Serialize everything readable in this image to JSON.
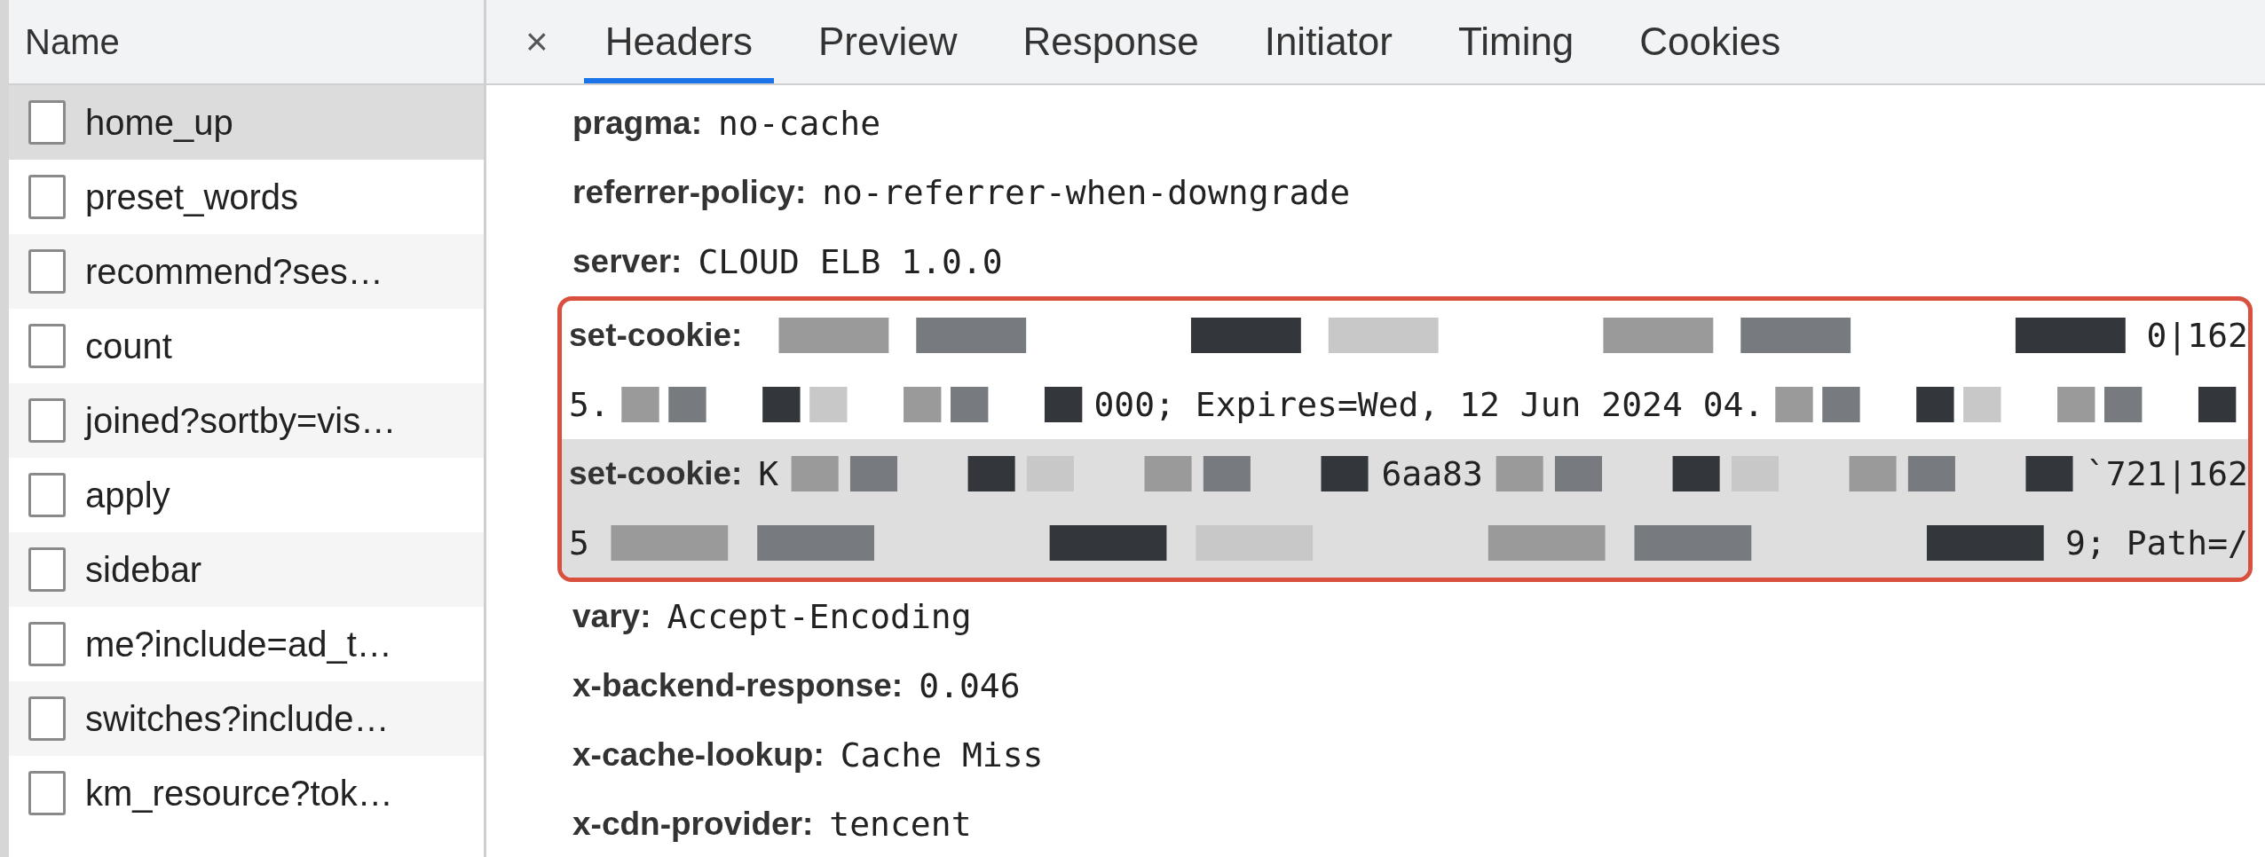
{
  "requests": {
    "column": "Name",
    "rows": [
      {
        "name": "home_up",
        "selected": true
      },
      {
        "name": "preset_words",
        "selected": false
      },
      {
        "name": "recommend?ses…",
        "selected": false
      },
      {
        "name": "count",
        "selected": false
      },
      {
        "name": "joined?sortby=vis…",
        "selected": false
      },
      {
        "name": "apply",
        "selected": false
      },
      {
        "name": "sidebar",
        "selected": false
      },
      {
        "name": "me?include=ad_t…",
        "selected": false
      },
      {
        "name": "switches?include…",
        "selected": false
      },
      {
        "name": "km_resource?tok…",
        "selected": false
      }
    ]
  },
  "details": {
    "close": "×",
    "tabs": [
      {
        "label": "Headers",
        "selected": true
      },
      {
        "label": "Preview",
        "selected": false
      },
      {
        "label": "Response",
        "selected": false
      },
      {
        "label": "Initiator",
        "selected": false
      },
      {
        "label": "Timing",
        "selected": false
      },
      {
        "label": "Cookies",
        "selected": false
      }
    ],
    "header_groups": [
      {
        "kind": "plain",
        "headers": [
          {
            "name": "pragma:",
            "highlighted": false,
            "lines": [
              [
                {
                  "kind": "text",
                  "text": "no-cache"
                }
              ]
            ]
          },
          {
            "name": "referrer-policy:",
            "highlighted": false,
            "lines": [
              [
                {
                  "kind": "text",
                  "text": "no-referrer-when-downgrade"
                }
              ]
            ]
          },
          {
            "name": "server:",
            "highlighted": false,
            "lines": [
              [
                {
                  "kind": "text",
                  "text": "CLOUD ELB 1.0.0"
                }
              ]
            ]
          }
        ]
      },
      {
        "kind": "outlined",
        "headers": [
          {
            "name": "set-cookie:",
            "highlighted": false,
            "lines": [
              [
                {
                  "kind": "redacted"
                },
                {
                  "kind": "text",
                  "text": "0|162"
                }
              ],
              [
                {
                  "kind": "text",
                  "text": "5."
                },
                {
                  "kind": "redacted"
                },
                {
                  "kind": "text",
                  "text": "000; Expires=Wed, 12 Jun 2024 04."
                },
                {
                  "kind": "redacted"
                }
              ]
            ]
          },
          {
            "name": "set-cookie:",
            "highlighted": true,
            "lines": [
              [
                {
                  "kind": "text",
                  "text": "K"
                },
                {
                  "kind": "redacted"
                },
                {
                  "kind": "text",
                  "text": "6aa83"
                },
                {
                  "kind": "redacted"
                },
                {
                  "kind": "text",
                  "text": "`721|162"
                }
              ],
              [
                {
                  "kind": "text",
                  "text": "5"
                },
                {
                  "kind": "redacted"
                },
                {
                  "kind": "text",
                  "text": "9; Path=/"
                }
              ]
            ]
          }
        ]
      },
      {
        "kind": "plain",
        "headers": [
          {
            "name": "vary:",
            "highlighted": false,
            "lines": [
              [
                {
                  "kind": "text",
                  "text": "Accept-Encoding"
                }
              ]
            ]
          },
          {
            "name": "x-backend-response:",
            "highlighted": false,
            "lines": [
              [
                {
                  "kind": "text",
                  "text": "0.046"
                }
              ]
            ]
          },
          {
            "name": "x-cache-lookup:",
            "highlighted": false,
            "lines": [
              [
                {
                  "kind": "text",
                  "text": "Cache Miss"
                }
              ]
            ]
          },
          {
            "name": "x-cdn-provider:",
            "highlighted": false,
            "lines": [
              [
                {
                  "kind": "text",
                  "text": "tencent"
                }
              ]
            ]
          }
        ]
      }
    ]
  }
}
